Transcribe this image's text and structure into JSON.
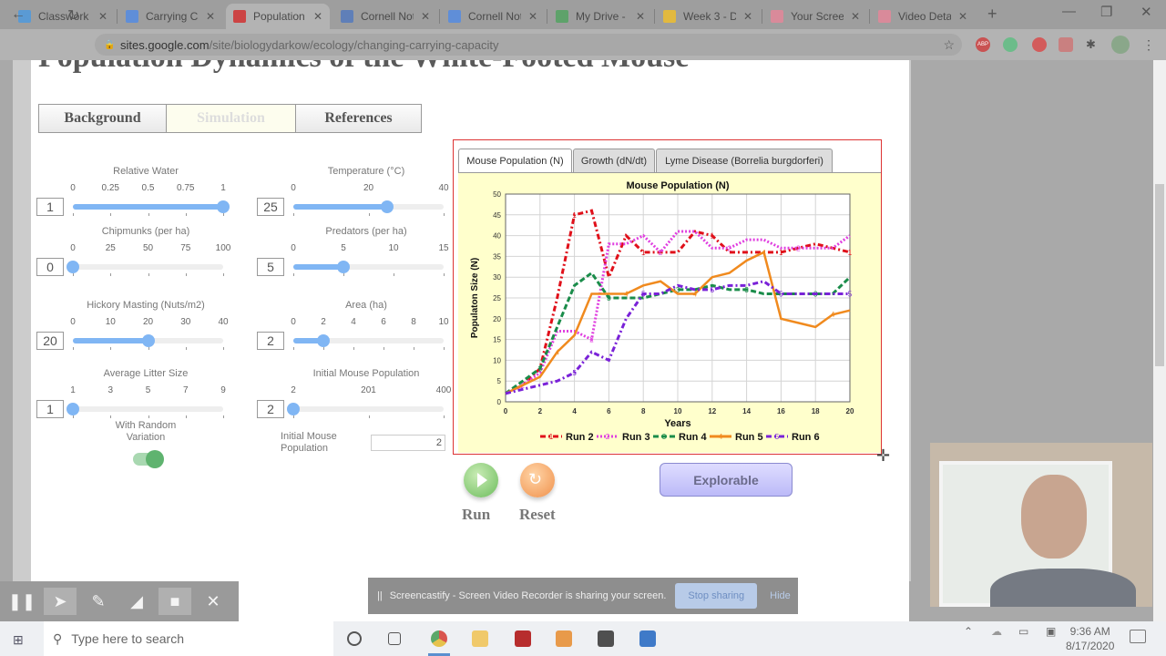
{
  "browser": {
    "tabs": [
      {
        "label": "Classwork f",
        "icon": "classroom-icon",
        "color": "#5a9ad4"
      },
      {
        "label": "Carrying Ca",
        "icon": "docs-icon",
        "color": "#5f8ed8"
      },
      {
        "label": "Population",
        "icon": "population-sim-icon",
        "color": "#c44",
        "active": true
      },
      {
        "label": "Cornell Not",
        "icon": "cornell-icon",
        "color": "#5f7fb8"
      },
      {
        "label": "Cornell Not",
        "icon": "docs-icon",
        "color": "#5f8ed8"
      },
      {
        "label": "My Drive - ",
        "icon": "drive-icon",
        "color": "#5ea26a"
      },
      {
        "label": "Week 3 - D",
        "icon": "slides-icon",
        "color": "#e2b93f"
      },
      {
        "label": "Your Screen",
        "icon": "screencastify-icon",
        "color": "#d98a9a"
      },
      {
        "label": "Video Deta",
        "icon": "screencastify-icon",
        "color": "#d98a9a"
      }
    ],
    "url_host": "sites.google.com",
    "url_path": "/site/biologydarkow/ecology/changing-carrying-capacity",
    "extensions": [
      "ABP",
      "",
      "",
      "",
      "",
      ""
    ]
  },
  "page": {
    "title": "Population Dynamics of the White-Footed Mouse",
    "nav_tabs": [
      "Background",
      "Simulation",
      "References"
    ],
    "selected_nav": "Simulation"
  },
  "controls": [
    {
      "label": "Relative Water",
      "ticks": [
        "0",
        "0.25",
        "0.5",
        "0.75",
        "1"
      ],
      "value": "1",
      "min": 0,
      "max": 1,
      "current": 1
    },
    {
      "label": "Temperature (°C)",
      "ticks": [
        "0",
        "20",
        "40"
      ],
      "value": "25",
      "min": 0,
      "max": 40,
      "current": 25
    },
    {
      "label": "Chipmunks (per ha)",
      "ticks": [
        "0",
        "25",
        "50",
        "75",
        "100"
      ],
      "value": "0",
      "min": 0,
      "max": 100,
      "current": 0
    },
    {
      "label": "Predators (per ha)",
      "ticks": [
        "0",
        "5",
        "10",
        "15"
      ],
      "value": "5",
      "min": 0,
      "max": 15,
      "current": 5
    },
    {
      "label": "Hickory Masting (Nuts/m2)",
      "ticks": [
        "0",
        "10",
        "20",
        "30",
        "40"
      ],
      "value": "20",
      "min": 0,
      "max": 40,
      "current": 20
    },
    {
      "label": "Area (ha)",
      "ticks": [
        "0",
        "2",
        "4",
        "6",
        "8",
        "10"
      ],
      "value": "2",
      "min": 0,
      "max": 10,
      "current": 2
    },
    {
      "label": "Average Litter Size",
      "ticks": [
        "1",
        "3",
        "5",
        "7",
        "9"
      ],
      "value": "1",
      "min": 1,
      "max": 9,
      "current": 1
    },
    {
      "label": "Initial Mouse Population",
      "ticks": [
        "2",
        "201",
        "400"
      ],
      "value": "2",
      "min": 2,
      "max": 400,
      "current": 2
    }
  ],
  "random_variation": {
    "label_line1": "With Random",
    "label_line2": "Variation",
    "on": true
  },
  "initial_pop_input": {
    "label_line1": "Initial Mouse",
    "label_line2": "Population",
    "value": "2"
  },
  "chart_tabs": [
    "Mouse Population (N)",
    "Growth (dN/dt)",
    "Lyme Disease (Borrelia burgdorferi)"
  ],
  "buttons": {
    "run": "Run",
    "reset": "Reset",
    "explorable": "Explorable"
  },
  "chart_data": {
    "type": "line",
    "title": "Mouse Population (N)",
    "xlabel": "Years",
    "ylabel": "Populaton Size (N)",
    "xlim": [
      0,
      20
    ],
    "ylim": [
      0,
      50
    ],
    "xticks": [
      0,
      2,
      4,
      6,
      8,
      10,
      12,
      14,
      16,
      18,
      20
    ],
    "yticks": [
      0,
      5,
      10,
      15,
      20,
      25,
      30,
      35,
      40,
      45,
      50
    ],
    "grid": true,
    "legend": "bottom",
    "x": [
      0,
      1,
      2,
      3,
      4,
      5,
      6,
      7,
      8,
      9,
      10,
      11,
      12,
      13,
      14,
      15,
      16,
      17,
      18,
      19,
      20
    ],
    "series": [
      {
        "name": "Run 2",
        "marker": "1",
        "color": "#e0101a",
        "style": "dashdot",
        "values": [
          2,
          4,
          8,
          25,
          45,
          46,
          30,
          40,
          36,
          36,
          36,
          41,
          40,
          36,
          36,
          36,
          36,
          37,
          38,
          37,
          36
        ]
      },
      {
        "name": "Run 3",
        "marker": "2",
        "color": "#e040e0",
        "style": "dotted",
        "values": [
          2,
          4,
          7,
          17,
          17,
          15,
          38,
          38,
          40,
          36,
          41,
          41,
          37,
          37,
          39,
          39,
          37,
          37,
          37,
          37,
          40
        ]
      },
      {
        "name": "Run 4",
        "marker": "3",
        "color": "#1a8c4a",
        "style": "dashed",
        "values": [
          2,
          5,
          8,
          18,
          28,
          31,
          25,
          25,
          25,
          26,
          27,
          27,
          28,
          27,
          27,
          26,
          26,
          26,
          26,
          26,
          30
        ]
      },
      {
        "name": "Run 5",
        "marker": "4",
        "color": "#f08a1e",
        "style": "solid",
        "values": [
          2,
          4,
          6,
          12,
          16,
          26,
          26,
          26,
          28,
          29,
          26,
          26,
          30,
          31,
          34,
          36,
          20,
          19,
          18,
          21,
          22
        ]
      },
      {
        "name": "Run 6",
        "marker": "5",
        "color": "#7a22d8",
        "style": "dashdot",
        "values": [
          2,
          3,
          4,
          5,
          7,
          12,
          10,
          20,
          26,
          26,
          28,
          27,
          27,
          28,
          28,
          29,
          26,
          26,
          26,
          26,
          26
        ]
      }
    ]
  },
  "annotation_toolbar": [
    "pause-icon",
    "cursor-icon",
    "pen-icon",
    "highlighter-icon",
    "camera-icon",
    "close-icon"
  ],
  "screencastify": {
    "message": "Screencastify - Screen Video Recorder is sharing your screen.",
    "stop": "Stop sharing",
    "hide": "Hide"
  },
  "taskbar": {
    "search_placeholder": "Type here to search",
    "time": "9:36 AM",
    "date": "8/17/2020"
  }
}
